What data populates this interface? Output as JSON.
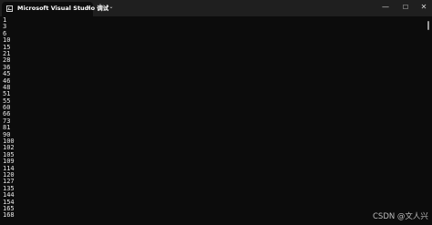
{
  "tab": {
    "icon": "terminal-icon",
    "title": "Microsoft Visual Studio 调试",
    "close_glyph": "✕"
  },
  "titlebar": {
    "new_tab_glyph": "+",
    "dropdown_glyph": "⌄",
    "minimize_glyph": "—",
    "maximize_glyph": "☐",
    "close_glyph": "✕"
  },
  "console": {
    "lines": [
      "1",
      "3",
      "6",
      "10",
      "15",
      "21",
      "28",
      "36",
      "45",
      "46",
      "48",
      "51",
      "55",
      "60",
      "66",
      "73",
      "81",
      "90",
      "100",
      "102",
      "105",
      "109",
      "114",
      "120",
      "127",
      "135",
      "144",
      "154",
      "165",
      "168"
    ]
  },
  "watermark": "CSDN @文人兴"
}
